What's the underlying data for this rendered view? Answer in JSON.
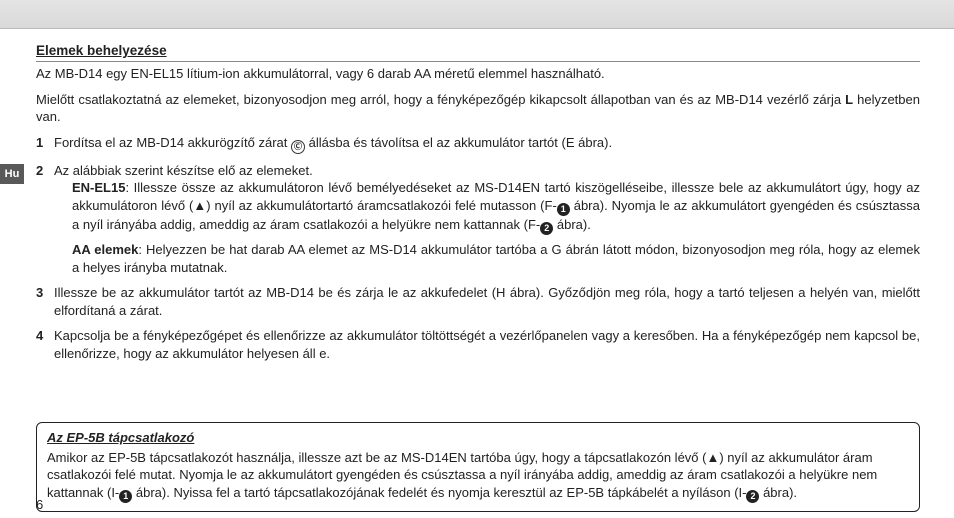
{
  "language_tab": "Hu",
  "section_title": "Elemek behelyezése",
  "intro": "Az MB-D14 egy EN-EL15 lítium-ion akkumulátorral, vagy 6 darab AA méretű elemmel használható.",
  "precheck_a": "Mielőtt csatlakoztatná az elemeket, bizonyosodjon meg arról, hogy a fényképezőgép kikapcsolt állapotban van és az MB-D14 vezérlő zárja ",
  "precheck_lock": "L",
  "precheck_b": " helyzetben van.",
  "step1_a": "Fordítsa el az MB-D14 akkurögzítő zárat ",
  "step1_b": " állásba és távolítsa el az akkumulátor tartót (E ábra).",
  "step2": "Az alábbiak szerint készítse elő az elemeket.",
  "enel_label": "EN-EL15",
  "enel_a": ": Illessze össze az akkumulátoron lévő bemélyedéseket az MS-D14EN tartó kiszögelléseibe, illessze bele az akkumulátort úgy, hogy az akkumulátoron lévő (",
  "enel_b": ") nyíl az akkumulátortartó áramcsatlakozói felé mutasson (F-",
  "enel_c": " ábra). Nyomja le az akkumulátort gyengéden és csúsztassa a nyíl irányába addig, ameddig az áram csatlakozói a helyükre nem kattannak (F-",
  "enel_d": " ábra).",
  "aa_label": "AA elemek",
  "aa_text": ": Helyezzen be hat darab AA elemet az MS-D14 akkumulátor tartóba a G ábrán látott módon, bizonyosodjon meg róla, hogy az elemek a helyes irányba mutatnak.",
  "step3": "Illessze be az akkumulátor tartót az MB-D14 be és zárja le az akkufedelet (H ábra). Győződjön meg róla, hogy a tartó teljesen a helyén van, mielőtt elfordítaná a zárat.",
  "step4": "Kapcsolja be a fényképezőgépet és ellenőrizze az akkumulátor töltöttségét a vezérlőpanelen vagy a keresőben. Ha a fényképezőgép nem kapcsol be, ellenőrizze, hogy az akkumulátor helyesen áll e.",
  "callout_title": "Az EP-5B tápcsatlakozó",
  "callout_a": "Amikor az EP-5B tápcsatlakozót használja, illessze azt be az MS-D14EN tartóba úgy, hogy a tápcsatlakozón lévő (",
  "callout_b": ") nyíl az akkumulátor áram csatlakozói felé mutat. Nyomja le az akkumulátort gyengéden és csúsztassa a nyíl irányába addig, ameddig az áram csatlakozói a helyükre nem kattannak (I-",
  "callout_c": " ábra). Nyissa fel a tartó tápcsatlakozójának fedelét és nyomja keresztül az EP-5B tápkábelét a nyíláson (I-",
  "callout_d": " ábra).",
  "circ1": "1",
  "circ2": "2",
  "triangle": "▲",
  "lock_glyph": "🔓",
  "page_number": "6"
}
